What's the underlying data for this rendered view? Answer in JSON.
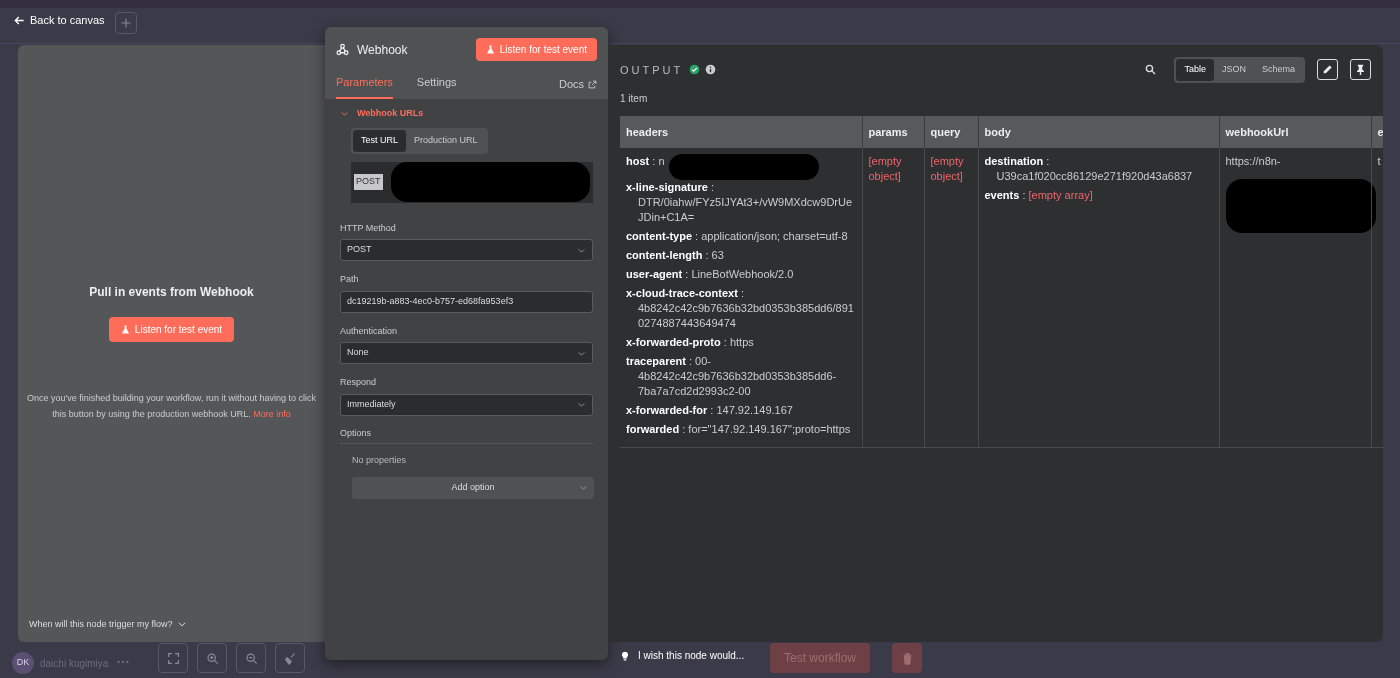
{
  "back_link": "Back to canvas",
  "canvas": {
    "user": {
      "initials": "DK",
      "name": "daichi kugimiya"
    },
    "test_button": "Test workflow"
  },
  "trigger_panel": {
    "heading": "Pull in events from Webhook",
    "button": "Listen for test event",
    "description": "Once you've finished building your workflow, run it without having to click this button by using the production webhook URL.",
    "link": "More info",
    "footer": "When will this node trigger my flow?"
  },
  "node_panel": {
    "title": "Webhook",
    "listen_button": "Listen for test event",
    "tabs": [
      {
        "label": "Parameters",
        "selected": true
      },
      {
        "label": "Settings",
        "selected": false
      }
    ],
    "docs": "Docs",
    "section": {
      "title": "Webhook URLs",
      "expanded": true
    },
    "url_tabs": [
      {
        "label": "Test URL",
        "selected": true
      },
      {
        "label": "Production URL",
        "selected": false
      }
    ],
    "url": {
      "method": "POST",
      "redacted": true
    },
    "fields": [
      {
        "label": "HTTP Method",
        "kind": "select",
        "value": "POST"
      },
      {
        "label": "Path",
        "kind": "text",
        "value": "dc19219b-a883-4ec0-b757-ed68fa953ef3"
      },
      {
        "label": "Authentication",
        "kind": "select",
        "value": "None"
      },
      {
        "label": "Respond",
        "kind": "select",
        "value": "Immediately"
      }
    ],
    "options": {
      "label": "Options",
      "empty_text": "No properties",
      "add_button": "Add option"
    }
  },
  "feedback": "I wish this node would...",
  "output": {
    "title": "OUTPUT",
    "views": [
      {
        "label": "Table",
        "selected": true
      },
      {
        "label": "JSON",
        "selected": false
      },
      {
        "label": "Schema",
        "selected": false
      }
    ],
    "count": "1 item",
    "table": {
      "separator": ":",
      "columns": [
        "headers",
        "params",
        "query",
        "body",
        "webhookUrl",
        "e"
      ],
      "rows": [
        {
          "cells": [
            {
              "entries": [
                {
                  "key": "host",
                  "value": "n",
                  "redacted": true
                },
                {
                  "key": "x-line-signature",
                  "value": "DTR/0iahw/FYz5IJYAt3+/vW9MXdcw9DrUeJDin+C1A="
                },
                {
                  "key": "content-type",
                  "value": "application/json; charset=utf-8"
                },
                {
                  "key": "content-length",
                  "value": "63"
                },
                {
                  "key": "user-agent",
                  "value": "LineBotWebhook/2.0"
                },
                {
                  "key": "x-cloud-trace-context",
                  "value": "4b8242c42c9b7636b32bd0353b385dd6/8910274887443649474"
                },
                {
                  "key": "x-forwarded-proto",
                  "value": "https"
                },
                {
                  "key": "traceparent",
                  "value": "00-4b8242c42c9b7636b32bd0353b385dd6-7ba7a7cd2d2993c2-00"
                },
                {
                  "key": "x-forwarded-for",
                  "value": "147.92.149.167"
                },
                {
                  "key": "forwarded",
                  "value": "for=\"147.92.149.167\";proto=https"
                }
              ]
            },
            {
              "value": "[empty object]",
              "empty": true
            },
            {
              "value": "[empty object]",
              "empty": true
            },
            {
              "entries": [
                {
                  "key": "destination",
                  "value": "U39ca1f020cc86129e271f920d43a6837"
                },
                {
                  "key": "events",
                  "value": "[empty array]",
                  "empty": true
                }
              ]
            },
            {
              "value": "https://n8n-",
              "redacted": true
            },
            {
              "value": "t"
            }
          ]
        }
      ]
    }
  }
}
